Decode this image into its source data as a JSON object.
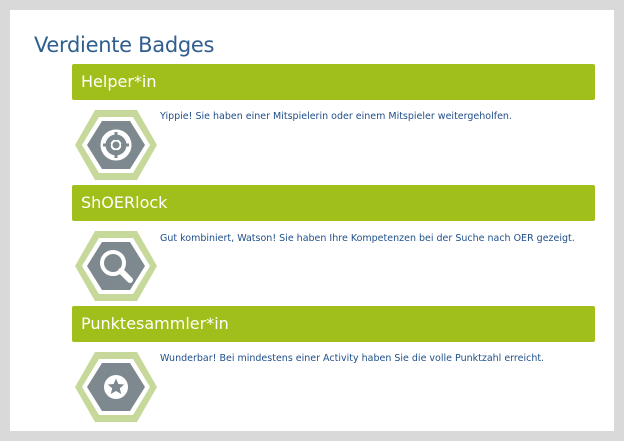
{
  "page": {
    "title": "Verdiente Badges"
  },
  "badges": [
    {
      "name": "Helper*in",
      "description": "Yippie! Sie haben einer Mitspielerin oder einem Mitspieler weitergeholfen.",
      "icon": "lifebuoy-icon"
    },
    {
      "name": "ShOERlock",
      "description": "Gut kombiniert, Watson! Sie haben Ihre Kompetenzen bei der Suche nach OER gezeigt.",
      "icon": "magnifier-icon"
    },
    {
      "name": "Punktesammler*in",
      "description": "Wunderbar! Bei mindestens einer Activity haben Sie die volle Punktzahl erreicht.",
      "icon": "star-icon"
    }
  ],
  "colors": {
    "header_green": "#a1bf1b",
    "hex_outer": "#c7d99a",
    "hex_inner": "#7d888f",
    "title_blue": "#2f5e8f",
    "text_blue": "#1f4f8a"
  }
}
